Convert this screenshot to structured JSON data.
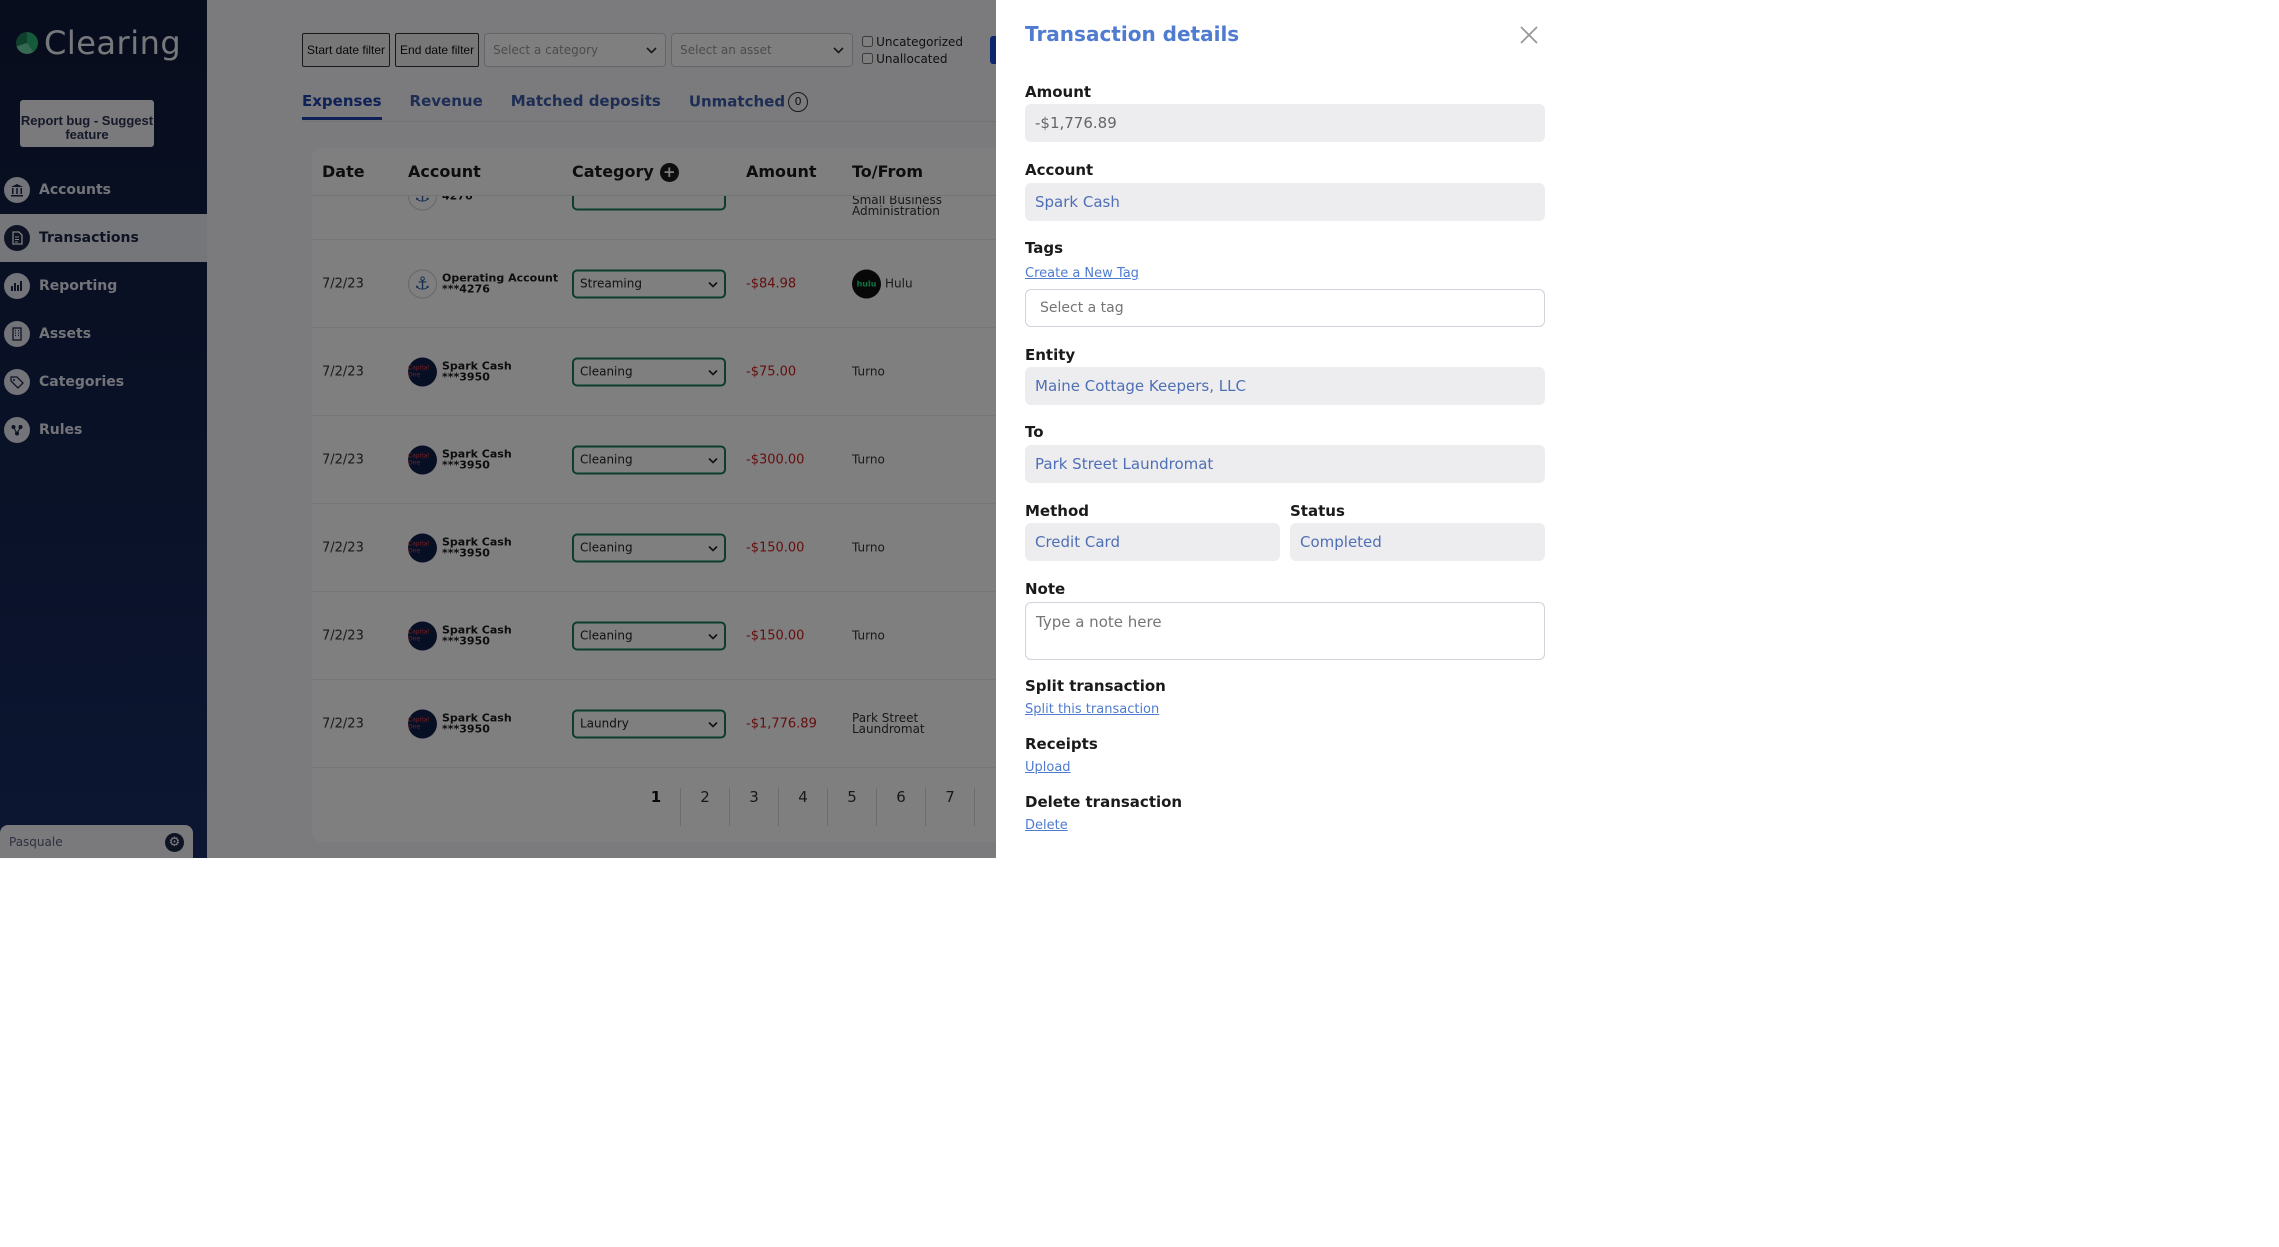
{
  "app": {
    "name": "Clearing",
    "report_button": "Report bug - Suggest feature"
  },
  "sidebar": {
    "items": [
      {
        "label": "Accounts",
        "icon": "bank-icon",
        "active": false
      },
      {
        "label": "Transactions",
        "icon": "document-icon",
        "active": true
      },
      {
        "label": "Reporting",
        "icon": "chart-icon",
        "active": false
      },
      {
        "label": "Assets",
        "icon": "building-icon",
        "active": false
      },
      {
        "label": "Categories",
        "icon": "tag-icon",
        "active": false
      },
      {
        "label": "Rules",
        "icon": "rules-icon",
        "active": false
      }
    ],
    "user": "Pasquale"
  },
  "filters": {
    "start_date": "Start date filter",
    "end_date": "End date filter",
    "category_placeholder": "Select a category",
    "asset_placeholder": "Select an asset",
    "uncategorized": "Uncategorized",
    "unallocated": "Unallocated"
  },
  "tabs": [
    {
      "label": "Expenses",
      "active": true
    },
    {
      "label": "Revenue",
      "active": false
    },
    {
      "label": "Matched deposits",
      "active": false
    },
    {
      "label": "Unmatched",
      "active": false,
      "count": "0"
    }
  ],
  "table": {
    "headers": {
      "date": "Date",
      "account": "Account",
      "category": "Category",
      "amount": "Amount",
      "to_from": "To/From"
    },
    "partial_row": {
      "account_suffix": "4276",
      "to_from": "Small Business Administration"
    },
    "rows": [
      {
        "date": "7/2/23",
        "account": "Operating Account",
        "account_num": "***4276",
        "category": "Streaming",
        "amount": "-$84.98",
        "to_from": "Hulu"
      },
      {
        "date": "7/2/23",
        "account": "Spark Cash",
        "account_num": "***3950",
        "category": "Cleaning",
        "amount": "-$75.00",
        "to_from": "Turno"
      },
      {
        "date": "7/2/23",
        "account": "Spark Cash",
        "account_num": "***3950",
        "category": "Cleaning",
        "amount": "-$300.00",
        "to_from": "Turno"
      },
      {
        "date": "7/2/23",
        "account": "Spark Cash",
        "account_num": "***3950",
        "category": "Cleaning",
        "amount": "-$150.00",
        "to_from": "Turno"
      },
      {
        "date": "7/2/23",
        "account": "Spark Cash",
        "account_num": "***3950",
        "category": "Cleaning",
        "amount": "-$150.00",
        "to_from": "Turno"
      },
      {
        "date": "7/2/23",
        "account": "Spark Cash",
        "account_num": "***3950",
        "category": "Laundry",
        "amount": "-$1,776.89",
        "to_from": "Park Street Laundromat"
      }
    ],
    "pages": [
      "1",
      "2",
      "3",
      "4",
      "5",
      "6",
      "7"
    ],
    "current_page": "1"
  },
  "details": {
    "title": "Transaction details",
    "amount_label": "Amount",
    "amount": "-$1,776.89",
    "account_label": "Account",
    "account": "Spark Cash",
    "tags_label": "Tags",
    "create_tag": "Create a New Tag",
    "tag_placeholder": "Select a tag",
    "entity_label": "Entity",
    "entity": "Maine Cottage Keepers, LLC",
    "to_label": "To",
    "to": "Park Street Laundromat",
    "method_label": "Method",
    "method": "Credit Card",
    "status_label": "Status",
    "status": "Completed",
    "note_label": "Note",
    "note_placeholder": "Type a note here",
    "split_label": "Split transaction",
    "split_link": "Split this transaction",
    "receipts_label": "Receipts",
    "upload_link": "Upload",
    "delete_label": "Delete transaction",
    "delete_link": "Delete"
  }
}
